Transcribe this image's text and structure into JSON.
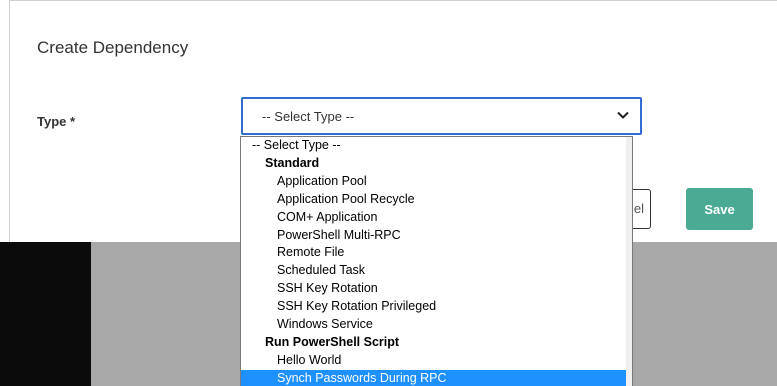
{
  "dialog": {
    "title": "Create Dependency",
    "type_label": "Type",
    "required_mark": "*",
    "select_value": "-- Select Type --",
    "cancel_partial": "el",
    "save_label": "Save"
  },
  "dropdown": {
    "placeholder": "-- Select Type --",
    "groups": [
      {
        "label": "Standard",
        "options": [
          "Application Pool",
          "Application Pool Recycle",
          "COM+ Application",
          "PowerShell Multi-RPC",
          "Remote File",
          "Scheduled Task",
          "SSH Key Rotation",
          "SSH Key Rotation Privileged",
          "Windows Service"
        ]
      },
      {
        "label": "Run PowerShell Script",
        "options": [
          "Hello World",
          "Synch Passwords During RPC"
        ]
      }
    ],
    "highlighted": "Synch Passwords During RPC"
  },
  "colors": {
    "accent": "#4aaa94",
    "select_border": "#2f6ecf",
    "highlight": "#1e90ff"
  },
  "icons": {
    "select_caret": "chevron-down-icon"
  }
}
